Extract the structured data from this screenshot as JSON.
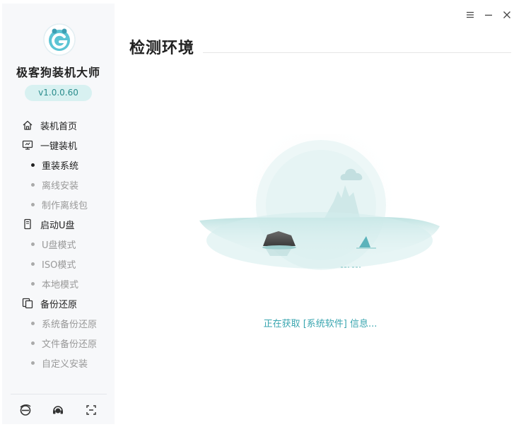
{
  "app": {
    "name": "极客狗装机大师",
    "version": "v1.0.0.60"
  },
  "nav": [
    {
      "type": "group",
      "label": "装机首页",
      "icon": "home-icon"
    },
    {
      "type": "group",
      "label": "一键装机",
      "icon": "monitor-icon"
    },
    {
      "type": "sub",
      "label": "重装系统",
      "active": true
    },
    {
      "type": "sub",
      "label": "离线安装",
      "active": false
    },
    {
      "type": "sub",
      "label": "制作离线包",
      "active": false
    },
    {
      "type": "group",
      "label": "启动U盘",
      "icon": "usb-drive-icon"
    },
    {
      "type": "sub",
      "label": "U盘模式",
      "active": false
    },
    {
      "type": "sub",
      "label": "ISO模式",
      "active": false
    },
    {
      "type": "sub",
      "label": "本地模式",
      "active": false
    },
    {
      "type": "group",
      "label": "备份还原",
      "icon": "backup-icon"
    },
    {
      "type": "sub",
      "label": "系统备份还原",
      "active": false
    },
    {
      "type": "sub",
      "label": "文件备份还原",
      "active": false
    },
    {
      "type": "sub",
      "label": "自定义安装",
      "active": false
    }
  ],
  "bottom_icons": [
    "browser-icon",
    "support-headset-icon",
    "screenshot-icon"
  ],
  "window_controls": [
    "menu-icon",
    "minimize-icon",
    "close-icon"
  ],
  "main": {
    "title": "检测环境",
    "status": "正在获取 [系统软件] 信息..."
  },
  "colors": {
    "accent": "#3aa6b0",
    "version_bg": "#d8f1f1",
    "sidebar_bg": "#f7f8fa"
  }
}
